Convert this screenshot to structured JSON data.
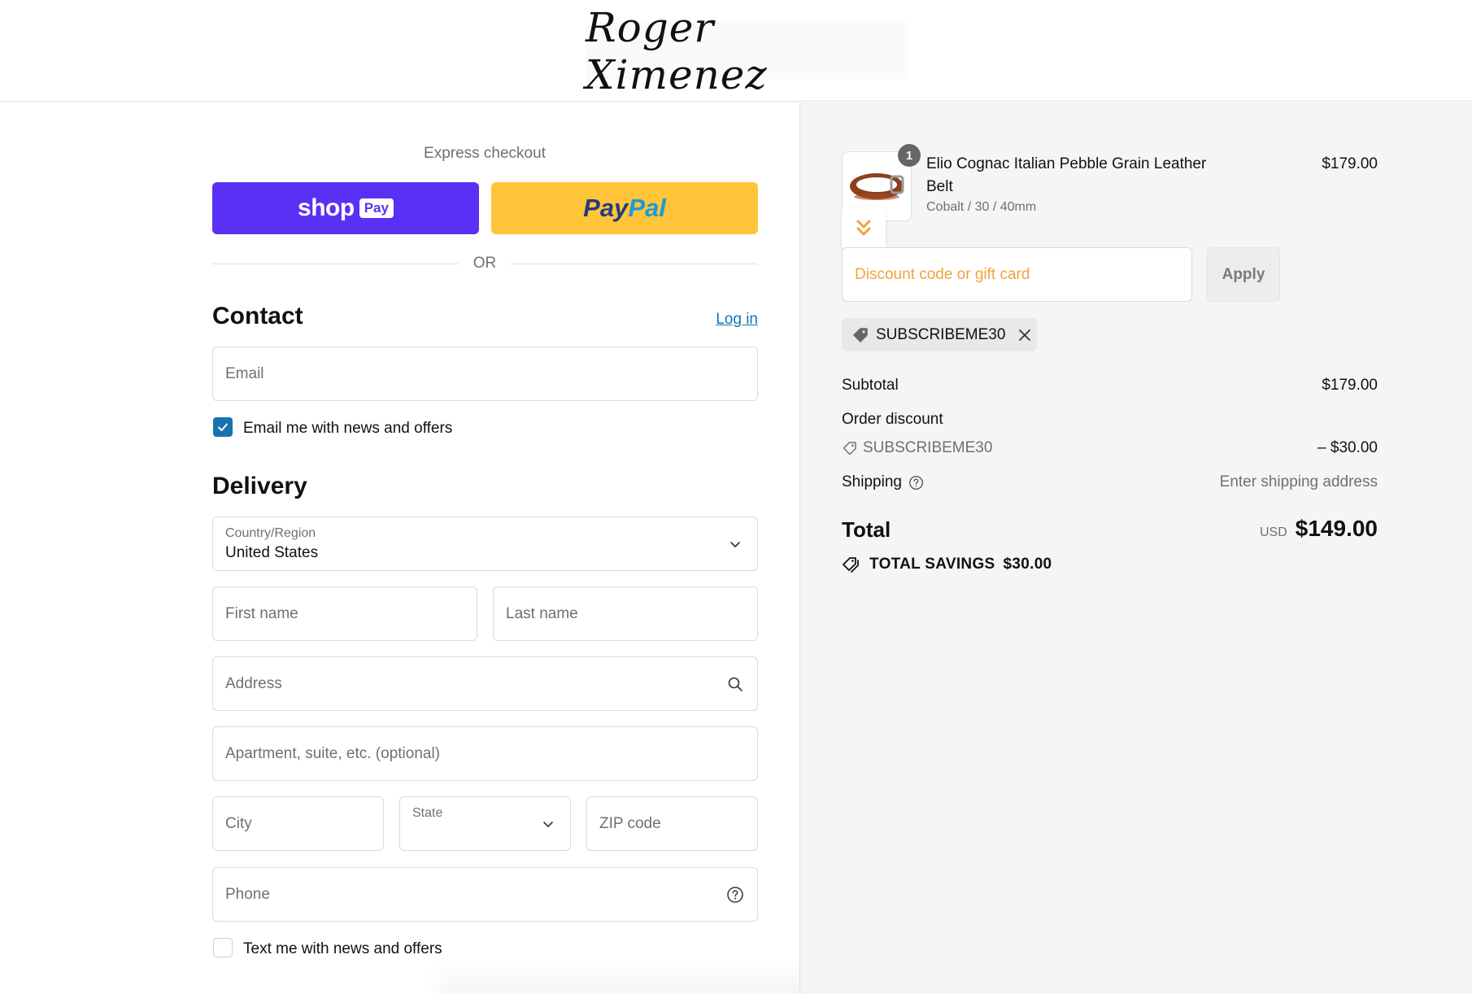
{
  "store": {
    "logo_text": "Roger Ximenez"
  },
  "express": {
    "label": "Express checkout",
    "shoppay_word": "shop",
    "shoppay_pay": "Pay",
    "paypal_a": "Pay",
    "paypal_b": "Pal",
    "or_text": "OR"
  },
  "contact": {
    "title": "Contact",
    "login_label": "Log in",
    "email_placeholder": "Email",
    "news_checkbox_label": "Email me with news and offers",
    "news_checked": true
  },
  "delivery": {
    "title": "Delivery",
    "country_label": "Country/Region",
    "country_value": "United States",
    "first_name_placeholder": "First name",
    "last_name_placeholder": "Last name",
    "address_placeholder": "Address",
    "apartment_placeholder": "Apartment, suite, etc. (optional)",
    "city_placeholder": "City",
    "state_label": "State",
    "zip_placeholder": "ZIP code",
    "phone_placeholder": "Phone",
    "sms_checkbox_label": "Text me with news and offers",
    "sms_checked": false
  },
  "summary": {
    "product": {
      "quantity": "1",
      "name": "Elio Cognac Italian Pebble Grain Leather Belt",
      "variant": "Cobalt / 30 / 40mm",
      "price": "$179.00"
    },
    "discount_placeholder": "Discount code or gift card",
    "apply_label": "Apply",
    "applied_code": "SUBSCRIBEME30",
    "subtotal_label": "Subtotal",
    "subtotal_value": "$179.00",
    "order_discount_label": "Order discount",
    "order_discount_code": "SUBSCRIBEME30",
    "order_discount_value": "– $30.00",
    "shipping_label": "Shipping",
    "shipping_value": "Enter shipping address",
    "total_label": "Total",
    "total_currency": "USD",
    "total_value": "$149.00",
    "savings_label": "TOTAL SAVINGS",
    "savings_value": "$30.00"
  },
  "colors": {
    "shoppay": "#5a31f4",
    "paypal": "#ffc439",
    "link": "#1773b0",
    "discount_placeholder": "#f2a33a"
  }
}
